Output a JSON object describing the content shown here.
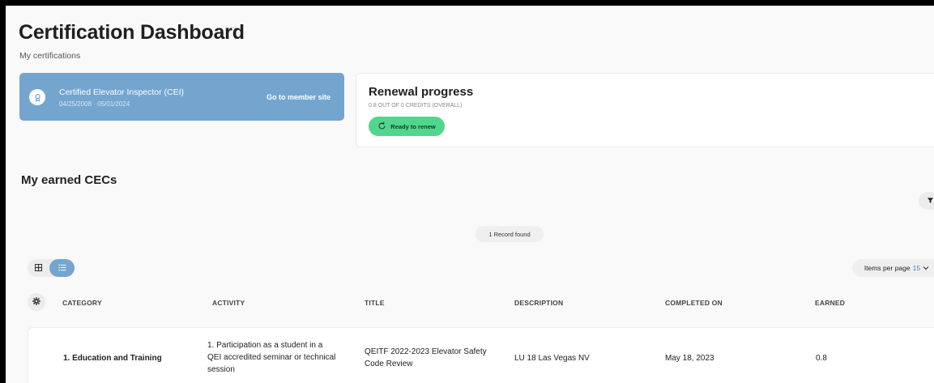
{
  "page": {
    "title": "Certification Dashboard",
    "subtitle": "My certifications"
  },
  "certification": {
    "name": "Certified Elevator Inspector (CEI)",
    "dates": "04/25/2008 · 05/01/2024",
    "link_label": "Go to member site",
    "icon": "ribbon-icon"
  },
  "renewal": {
    "title": "Renewal progress",
    "subtitle": "0.8 OUT OF 0 CREDITS (OVERALL)",
    "button_label": "Ready to renew",
    "button_color": "#52d68e"
  },
  "cecs": {
    "section_title": "My earned CECs",
    "records_found": "1 Record found",
    "items_per_page_label": "Items per page",
    "items_per_page_value": "15",
    "view_mode": "list",
    "columns": [
      "CATEGORY",
      "ACTIVITY",
      "TITLE",
      "DESCRIPTION",
      "COMPLETED ON",
      "EARNED"
    ],
    "rows": [
      {
        "category": "1. Education and Training",
        "activity": "1. Participation as a student in a QEI accredited seminar or technical session",
        "title": "QEITF 2022-2023 Elevator Safety Code Review",
        "description": "LU 18 Las Vegas NV",
        "completed_on": "May 18, 2023",
        "earned": "0.8"
      }
    ]
  },
  "colors": {
    "accent": "#74a5cf",
    "link": "#3d86c6",
    "success": "#52d68e"
  }
}
